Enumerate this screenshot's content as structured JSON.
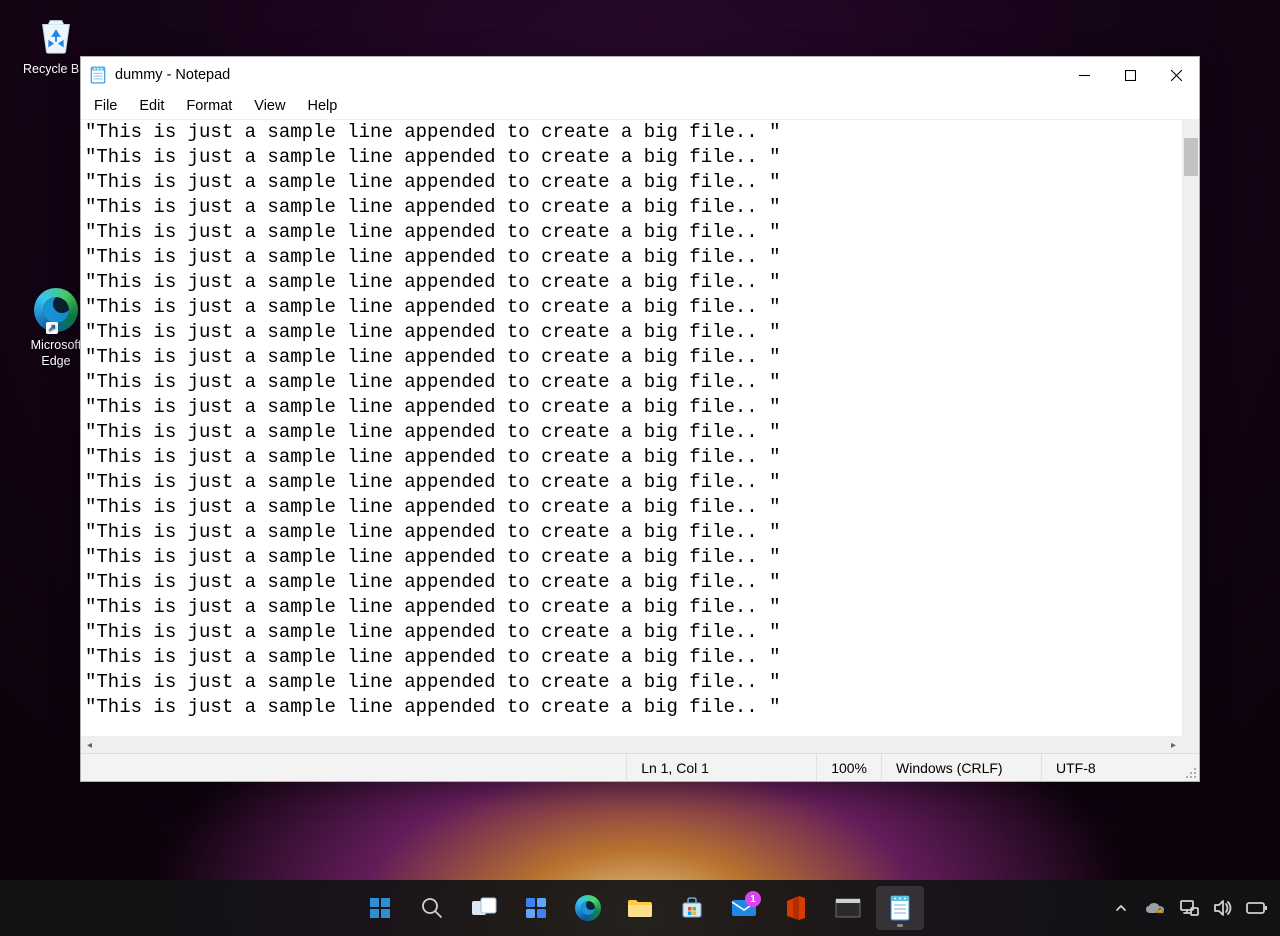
{
  "desktop": {
    "icons": {
      "recycle_bin": "Recycle Bin",
      "edge": "Microsoft Edge"
    }
  },
  "window": {
    "title": "dummy - Notepad",
    "menu": {
      "file": "File",
      "edit": "Edit",
      "format": "Format",
      "view": "View",
      "help": "Help"
    },
    "content_line": "\"This is just a sample line appended to create a big file.. \"",
    "line_count": 24,
    "statusbar": {
      "position": "Ln 1, Col 1",
      "zoom": "100%",
      "eol": "Windows (CRLF)",
      "encoding": "UTF-8"
    }
  },
  "taskbar": {
    "mail_badge": "1"
  }
}
